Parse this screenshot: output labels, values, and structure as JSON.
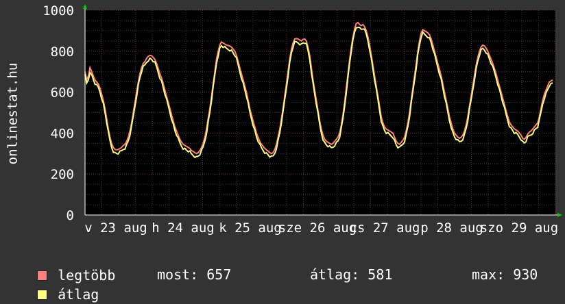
{
  "chart_data": {
    "type": "line",
    "ylabel": "onlinestat.hu",
    "ylim": [
      0,
      1000
    ],
    "yticks": [
      "0",
      "200",
      "400",
      "600",
      "800",
      "1000"
    ],
    "xtick_labels": [
      "v 23 aug",
      "h 24 aug",
      "k 25 aug",
      "sze 26 aug",
      "cs 27 aug",
      "p 28 aug",
      "szo 29 aug"
    ],
    "x_days": 7,
    "samples_per_day": 96,
    "series": [
      {
        "name": "legtöbb",
        "color": "#ff7f7f",
        "values": [
          700,
          660,
          680,
          720,
          700,
          680,
          660,
          650,
          640,
          620,
          590,
          560,
          520,
          470,
          420,
          380,
          350,
          330,
          320,
          318,
          320,
          325,
          330,
          340,
          340,
          350,
          365,
          390,
          420,
          460,
          505,
          545,
          590,
          640,
          680,
          700,
          720,
          735,
          750,
          760,
          770,
          778,
          780,
          775,
          760,
          740,
          710,
          690,
          670,
          640,
          610,
          590,
          560,
          520,
          480,
          440,
          410,
          390,
          370,
          345,
          330,
          320,
          310,
          305,
          315,
          335,
          370,
          410,
          460,
          520,
          580,
          640,
          700,
          760,
          800,
          830,
          845,
          840,
          830,
          825,
          820,
          810,
          800,
          790,
          780,
          760,
          740,
          710,
          680,
          650,
          620,
          590,
          560,
          530,
          500,
          470
        ],
        "days": [
          [
            700,
            660,
            680,
            720,
            700,
            680,
            660,
            650,
            640,
            620,
            590,
            560,
            520,
            470,
            420,
            380,
            350,
            330,
            320,
            318,
            320,
            325,
            330,
            340,
            345,
            360,
            380,
            410,
            450,
            500,
            550,
            600,
            650,
            690,
            720,
            740,
            750,
            765,
            775,
            780,
            778,
            770,
            760,
            740,
            715,
            690,
            670,
            640,
            610,
            580,
            550,
            520,
            490,
            460,
            430,
            410,
            390,
            370,
            355,
            345,
            340,
            335,
            330,
            325
          ],
          [
            315,
            310,
            305,
            300,
            305,
            315,
            330,
            350,
            380,
            420,
            470,
            520,
            580,
            640,
            700,
            760,
            800,
            830,
            845,
            840,
            835,
            830,
            828,
            825,
            820,
            810,
            800,
            780,
            750,
            720,
            690,
            660,
            630,
            600,
            560,
            520,
            490,
            460,
            430,
            400,
            380,
            360,
            345,
            335,
            325,
            318,
            312,
            305,
            300,
            305,
            320,
            345,
            380,
            420,
            470,
            520,
            580,
            640,
            700,
            760,
            810,
            840,
            860,
            862
          ],
          [
            860,
            855,
            850,
            858,
            860,
            850,
            820,
            780,
            720,
            660,
            610,
            560,
            510,
            460,
            420,
            390,
            370,
            360,
            355,
            350,
            345,
            350,
            360,
            370,
            380,
            400,
            440,
            490,
            550,
            620,
            690,
            760,
            820,
            870,
            910,
            935,
            940,
            930,
            925,
            930,
            920,
            900,
            870,
            830,
            780,
            730,
            680,
            630,
            580,
            530,
            480,
            450,
            430,
            420,
            415,
            410,
            405,
            400,
            380,
            360,
            350,
            345,
            355,
            365
          ],
          [
            380,
            410,
            450,
            500,
            560,
            620,
            680,
            740,
            800,
            850,
            890,
            905,
            900,
            895,
            890,
            880,
            860,
            830,
            800,
            770,
            740,
            710,
            680,
            640,
            600,
            560,
            520,
            480,
            450,
            420,
            400,
            390,
            380,
            375,
            380,
            390,
            410,
            440,
            480,
            530,
            580,
            630,
            680,
            730,
            770,
            800,
            820,
            830,
            825,
            815,
            800,
            780,
            760,
            740,
            715,
            690,
            660,
            630,
            600,
            570,
            540,
            510,
            480,
            455
          ],
          [
            440,
            430,
            420,
            415,
            410,
            400,
            390,
            375,
            370,
            380,
            395,
            405,
            410,
            420,
            430,
            440,
            450,
            480,
            520,
            560,
            590,
            610,
            630,
            650,
            655,
            660
          ]
        ]
      },
      {
        "name": "átlag",
        "color": "#ffff80"
      }
    ]
  },
  "legend": {
    "max_label": "legtöbb",
    "avg_label": "átlag",
    "current": "most: 657",
    "average": "átlag: 581",
    "maximum": "max: 930"
  }
}
